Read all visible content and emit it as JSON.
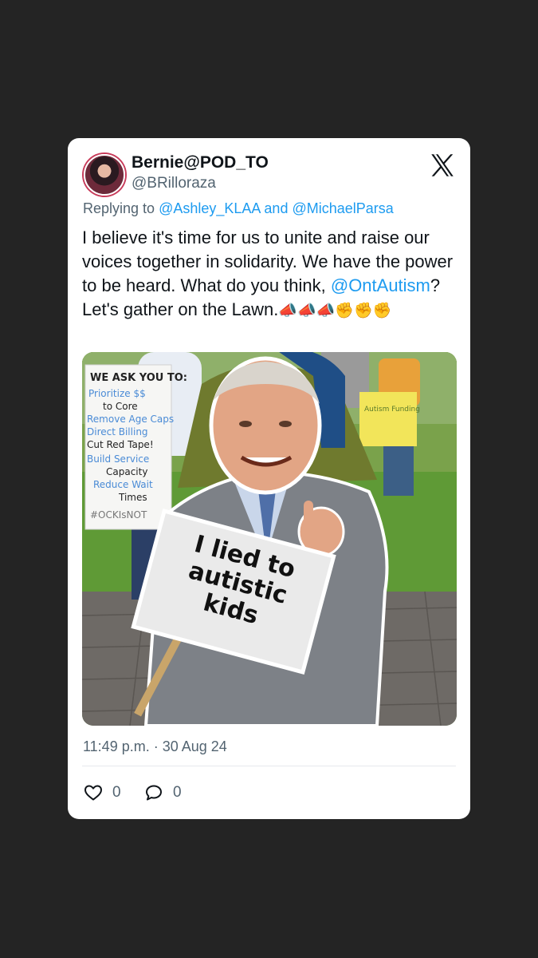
{
  "tweet": {
    "display_name": "Bernie@POD_TO",
    "handle": "@BRilloraza",
    "replying_prefix": "Replying to ",
    "reply_user_1": "@Ashley_KLAA",
    "reply_and": " and ",
    "reply_user_2": "@MichaelParsa",
    "text_part1": "I believe it's time for us to unite and raise our voices together in solidarity. We have the power to be heard. What do you think, ",
    "mention": "@OntAutism",
    "text_part2": "? Let's gather on the Lawn.",
    "emojis_megaphone": "📣📣📣",
    "emojis_fist": "✊✊✊",
    "timestamp": "11:49 p.m. · 30 Aug 24",
    "like_count": "0",
    "reply_count": "0"
  },
  "media": {
    "sign_main": "I lied to autistic kids",
    "sign_left_title": "WE ASK YOU TO:",
    "sign_left_lines": [
      "Prioritize $$",
      "to Core",
      "Remove Age Caps",
      "Direct Billing",
      "Cut Red Tape!",
      "Build Service",
      "Capacity",
      "Reduce Wait",
      "Times",
      "#OCKIsNOT"
    ],
    "sign_right": "Autism Funding"
  },
  "colors": {
    "background": "#242424",
    "card": "#ffffff",
    "link": "#1d9bf0",
    "muted": "#536471",
    "text": "#0f1419"
  },
  "icons": {
    "brand": "x-logo-icon",
    "like": "heart-icon",
    "reply": "reply-bubble-icon"
  }
}
